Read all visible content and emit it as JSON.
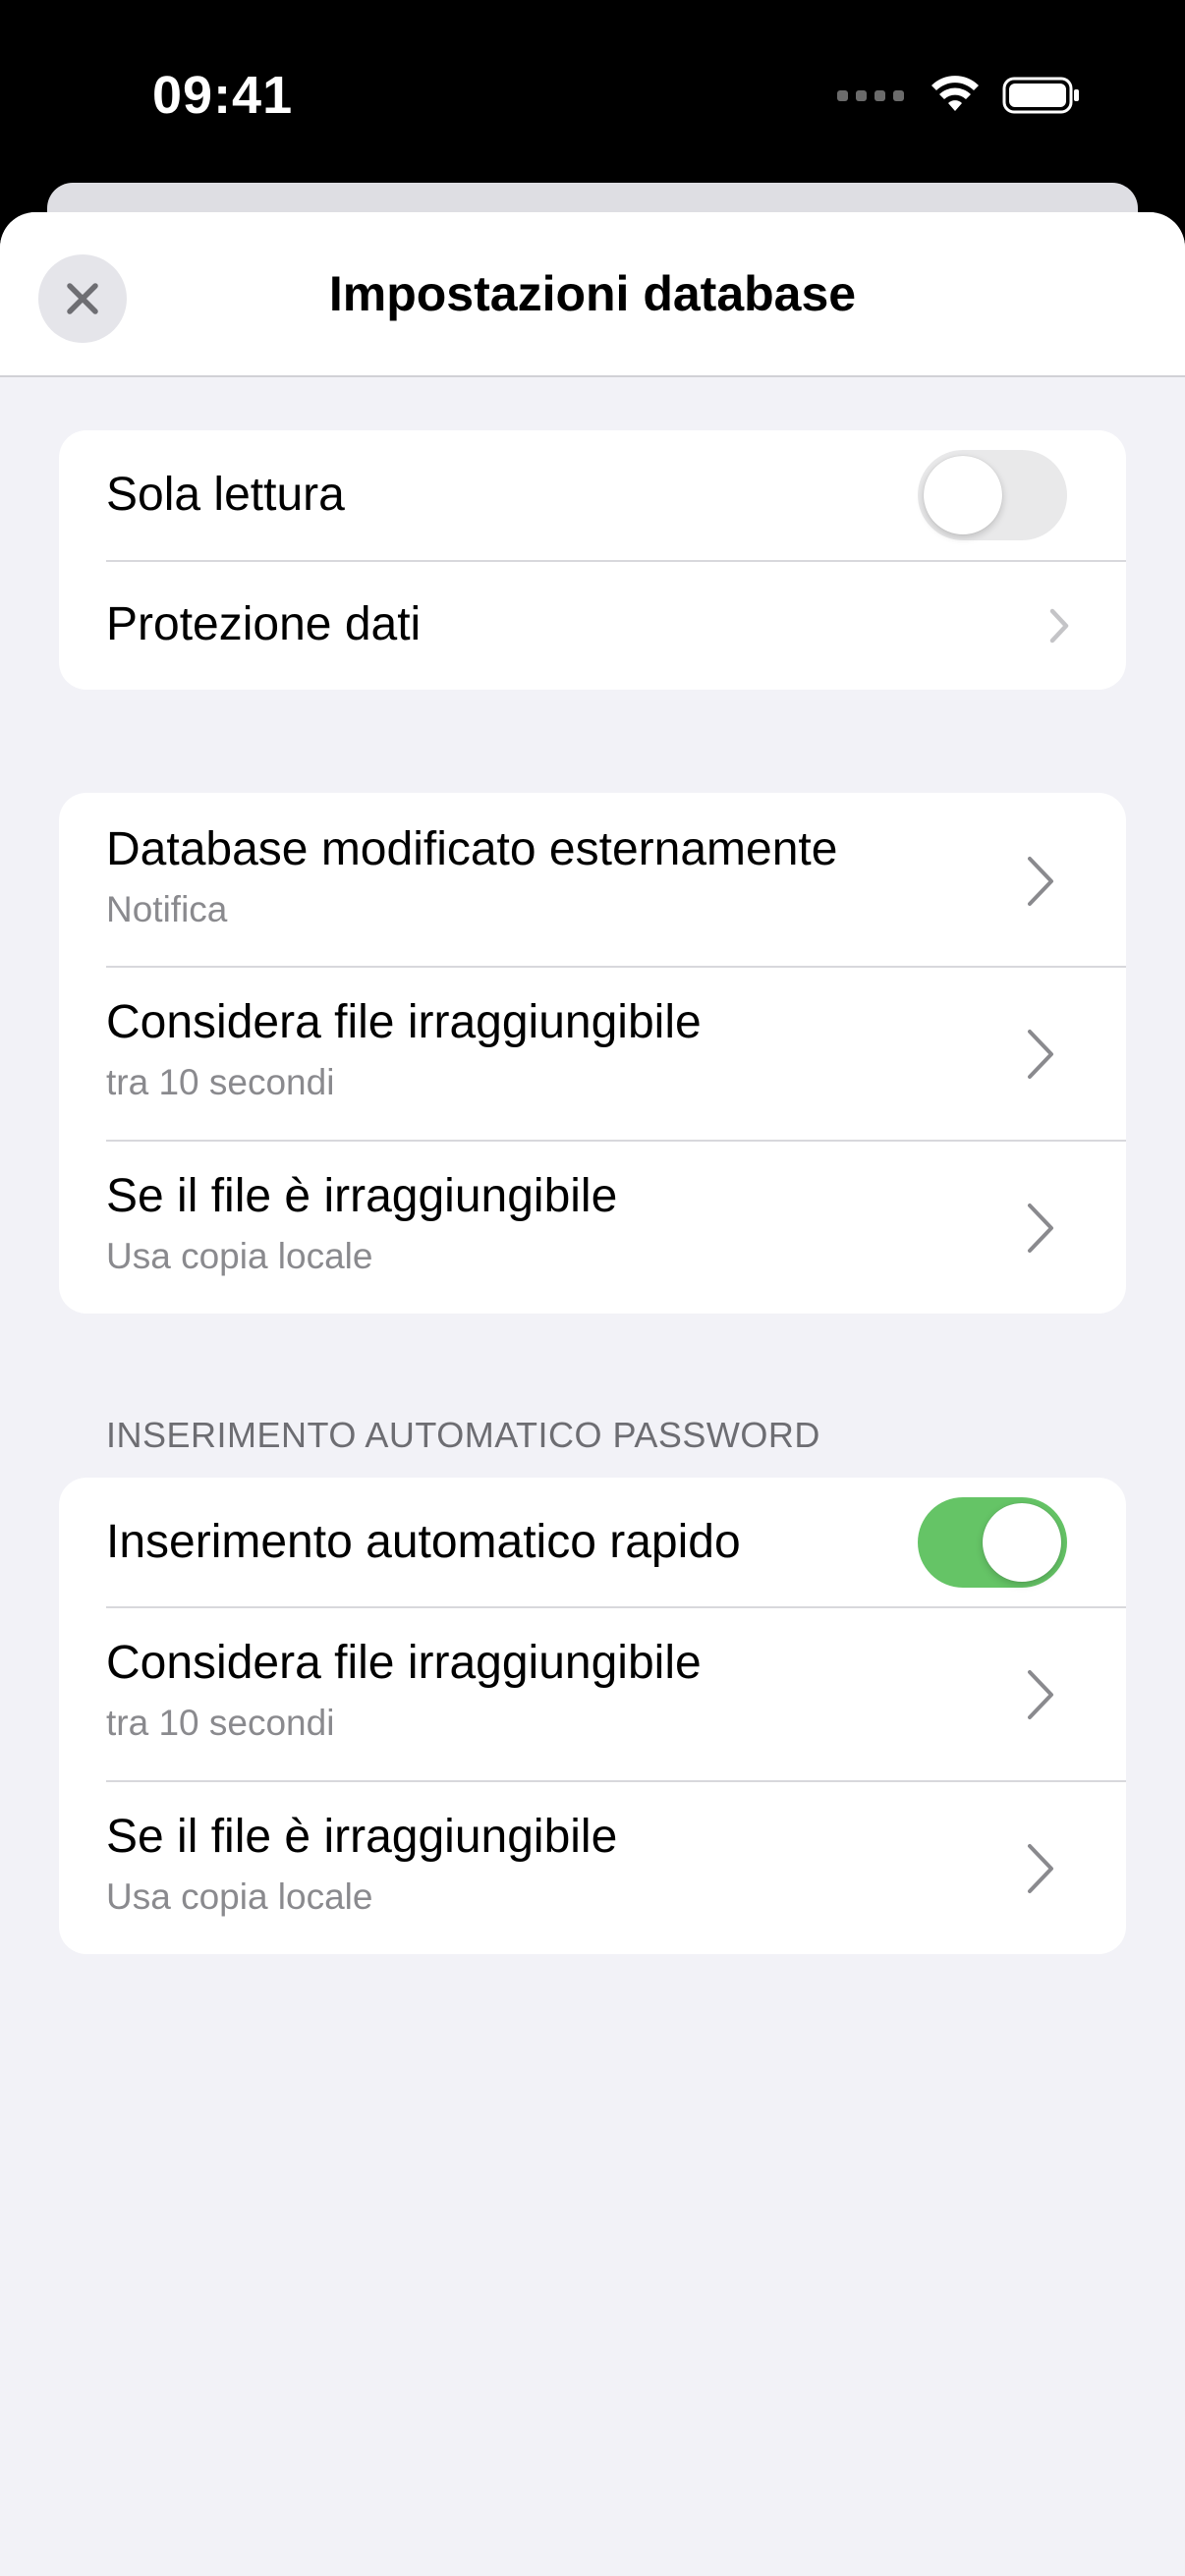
{
  "status_bar": {
    "time": "09:41"
  },
  "header": {
    "title": "Impostazioni database"
  },
  "group1": {
    "read_only": {
      "label": "Sola lettura",
      "enabled": false
    },
    "data_protection": {
      "label": "Protezione dati"
    }
  },
  "group2": {
    "rows": [
      {
        "label": "Database modificato esternamente",
        "value": "Notifica"
      },
      {
        "label": "Considera file irraggiungibile",
        "value": "tra 10 secondi"
      },
      {
        "label": "Se il file è irraggiungibile",
        "value": "Usa copia locale"
      }
    ]
  },
  "autofill": {
    "section_title": "INSERIMENTO AUTOMATICO PASSWORD",
    "quick_autofill": {
      "label": "Inserimento automatico rapido",
      "enabled": true
    },
    "rows": [
      {
        "label": "Considera file irraggiungibile",
        "value": "tra 10 secondi"
      },
      {
        "label": "Se il file è irraggiungibile",
        "value": "Usa copia locale"
      }
    ]
  },
  "colors": {
    "toggle_on": "#65c466",
    "background": "#f2f2f7"
  }
}
